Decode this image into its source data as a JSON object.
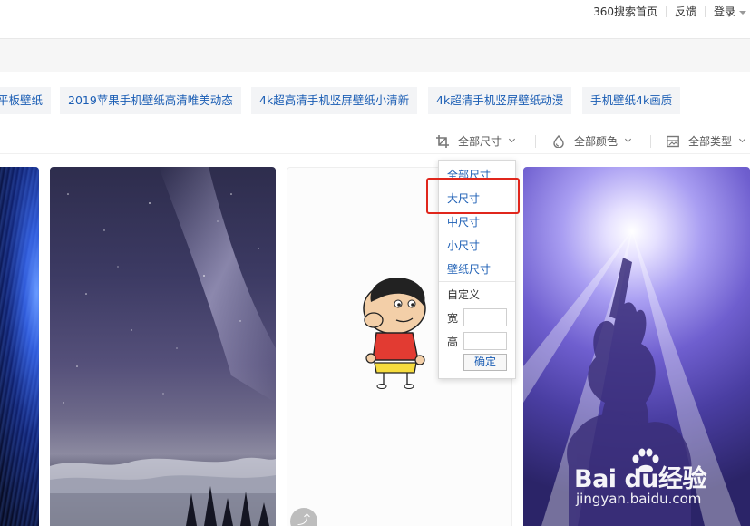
{
  "topnav": {
    "links": [
      {
        "label": "360搜索首页"
      },
      {
        "label": "反馈"
      },
      {
        "label": "登录"
      }
    ]
  },
  "tags": [
    {
      "label": "平板壁纸"
    },
    {
      "label": "2019苹果手机壁纸高清唯美动态"
    },
    {
      "label": "4k超高清手机竖屏壁纸小清新"
    },
    {
      "label": "4k超清手机竖屏壁纸动漫"
    },
    {
      "label": "手机壁纸4k画质"
    }
  ],
  "filters": {
    "size": {
      "label": "全部尺寸",
      "icon": "crop-icon"
    },
    "color": {
      "label": "全部颜色",
      "icon": "droplet-icon"
    },
    "type": {
      "label": "全部类型",
      "icon": "image-icon"
    }
  },
  "size_dropdown": {
    "options": [
      {
        "label": "全部尺寸"
      },
      {
        "label": "大尺寸"
      },
      {
        "label": "中尺寸"
      },
      {
        "label": "小尺寸"
      },
      {
        "label": "壁纸尺寸"
      }
    ],
    "custom_label": "自定义",
    "width_label": "宽",
    "height_label": "高",
    "width_value": "",
    "height_value": "",
    "confirm_label": "确定"
  },
  "colors": {
    "link": "#1a5db4",
    "highlight": "#e0261c"
  },
  "watermark": {
    "main": "Bai du经验",
    "sub": "jingyan.baidu.com"
  }
}
